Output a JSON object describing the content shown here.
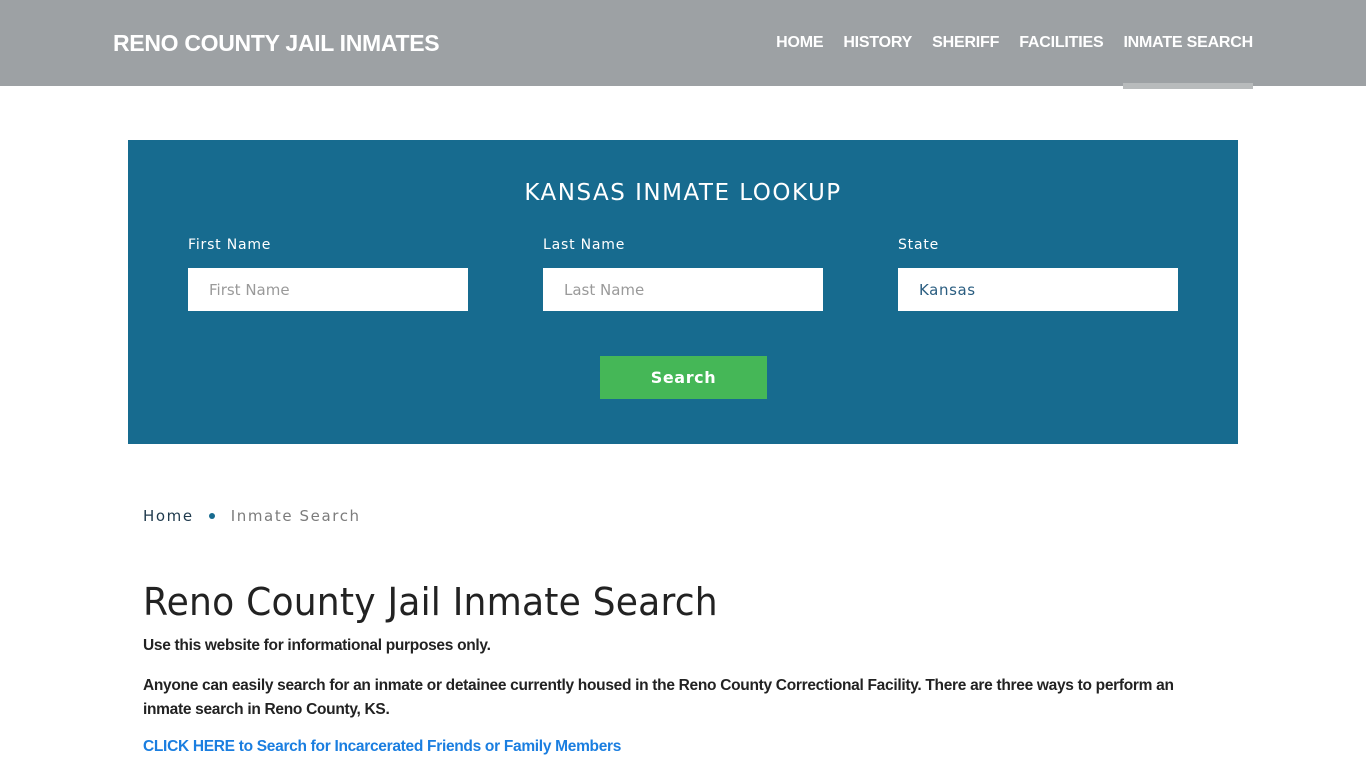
{
  "header": {
    "brand": "RENO COUNTY JAIL INMATES",
    "nav": [
      {
        "label": "HOME",
        "active": false
      },
      {
        "label": "HISTORY",
        "active": false
      },
      {
        "label": "SHERIFF",
        "active": false
      },
      {
        "label": "FACILITIES",
        "active": false
      },
      {
        "label": "INMATE SEARCH",
        "active": true
      }
    ]
  },
  "lookup": {
    "title": "KANSAS INMATE LOOKUP",
    "first_name": {
      "label": "First Name",
      "placeholder": "First Name",
      "value": ""
    },
    "last_name": {
      "label": "Last Name",
      "placeholder": "Last Name",
      "value": ""
    },
    "state": {
      "label": "State",
      "value": "Kansas"
    },
    "search_label": "Search",
    "colors": {
      "background": "#176b8f",
      "button": "#45b757"
    }
  },
  "breadcrumb": {
    "home": "Home",
    "current": "Inmate Search"
  },
  "content": {
    "title": "Reno County Jail Inmate Search",
    "paragraphs": [
      "Use this website for informational purposes only.",
      "Anyone can easily search for an inmate or detainee currently housed in the Reno County Correctional Facility. There are three ways to perform an inmate search in Reno County, KS."
    ],
    "link": "CLICK HERE to Search for Incarcerated Friends or Family Members"
  }
}
